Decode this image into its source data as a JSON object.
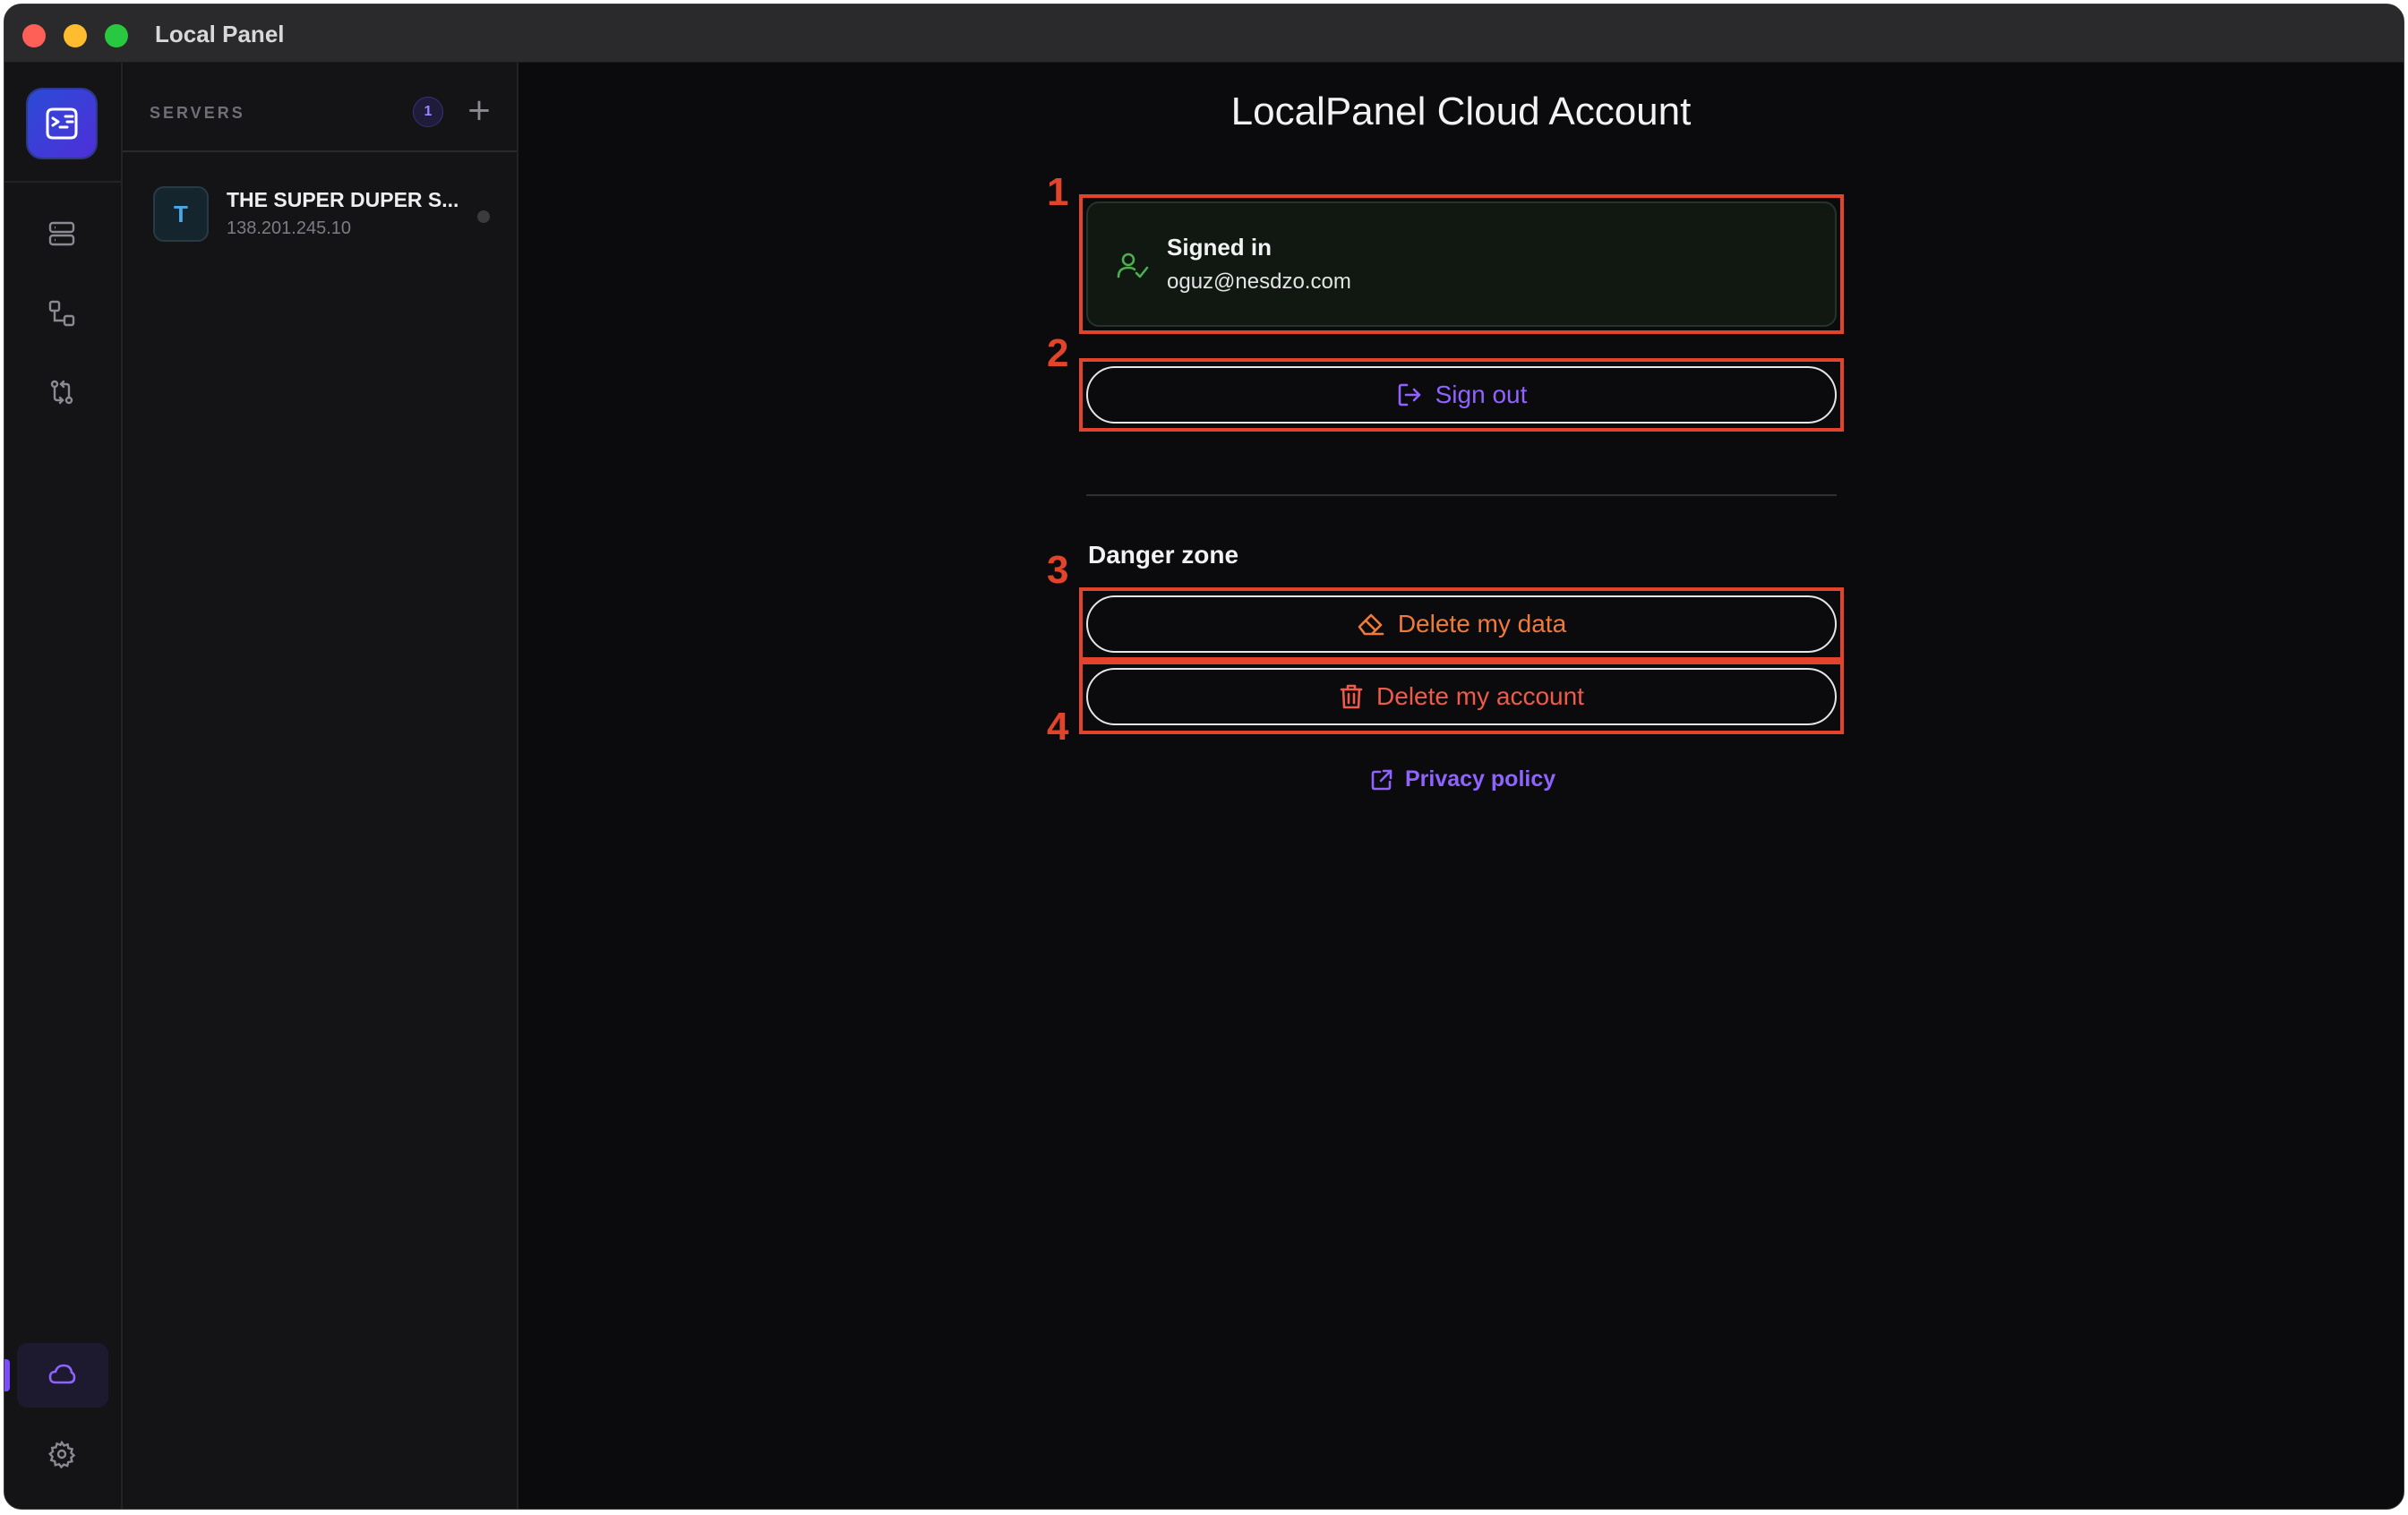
{
  "window": {
    "title": "Local Panel"
  },
  "sidebar": {
    "header_label": "SERVERS",
    "server_count": "1",
    "servers": [
      {
        "avatar_letter": "T",
        "name": "THE SUPER DUPER S...",
        "ip": "138.201.245.10",
        "status": "offline"
      }
    ]
  },
  "rail": {
    "items": [
      {
        "icon": "server-stack-icon"
      },
      {
        "icon": "workflow-icon"
      },
      {
        "icon": "git-compare-icon"
      },
      {
        "icon": "cloud-icon",
        "active": true
      },
      {
        "icon": "gear-icon"
      }
    ]
  },
  "main": {
    "title": "LocalPanel Cloud Account",
    "status_card": {
      "title": "Signed in",
      "email": "oguz@nesdzo.com"
    },
    "sign_out_label": "Sign out",
    "danger_zone_label": "Danger zone",
    "delete_data_label": "Delete my data",
    "delete_account_label": "Delete my account",
    "privacy_label": "Privacy policy"
  },
  "annotations": {
    "labels": [
      "1",
      "2",
      "3",
      "4"
    ]
  },
  "colors": {
    "accent": "#8f63ff",
    "success": "#4caf50",
    "warning": "#f07a3a",
    "danger": "#ef5a4a",
    "annotation": "#e2432b"
  }
}
